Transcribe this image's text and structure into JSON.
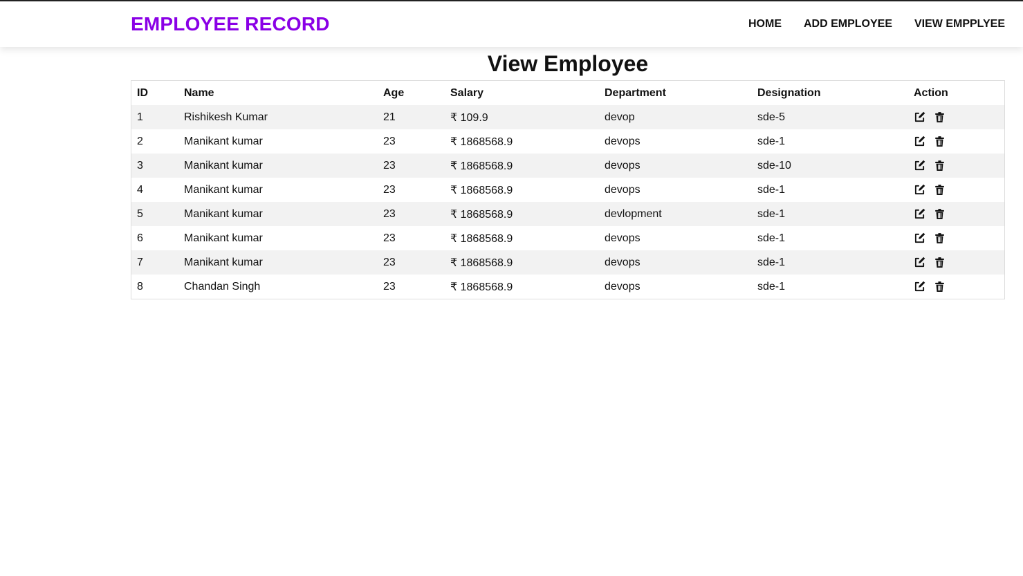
{
  "navbar": {
    "brand": "EMPLOYEE RECORD",
    "links": [
      "HOME",
      "ADD EMPLOYEE",
      "VIEW EMPPLYEE"
    ]
  },
  "page": {
    "title": "View Employee"
  },
  "table": {
    "headers": [
      "ID",
      "Name",
      "Age",
      "Salary",
      "Department",
      "Designation",
      "Action"
    ],
    "rows": [
      [
        "1",
        "Rishikesh Kumar",
        "21",
        "₹ 109.9",
        "devop",
        "sde-5"
      ],
      [
        "2",
        "Manikant kumar",
        "23",
        "₹ 1868568.9",
        "devops",
        "sde-1"
      ],
      [
        "3",
        "Manikant kumar",
        "23",
        "₹ 1868568.9",
        "devops",
        "sde-10"
      ],
      [
        "4",
        "Manikant kumar",
        "23",
        "₹ 1868568.9",
        "devops",
        "sde-1"
      ],
      [
        "5",
        "Manikant kumar",
        "23",
        "₹ 1868568.9",
        "devlopment",
        "sde-1"
      ],
      [
        "6",
        "Manikant kumar",
        "23",
        "₹ 1868568.9",
        "devops",
        "sde-1"
      ],
      [
        "7",
        "Manikant kumar",
        "23",
        "₹ 1868568.9",
        "devops",
        "sde-1"
      ],
      [
        "8",
        "Chandan Singh",
        "23",
        "₹ 1868568.9",
        "devops",
        "sde-1"
      ]
    ],
    "row_actions": [
      "edit-icon",
      "trash-icon"
    ]
  },
  "colors": {
    "brand": "#8a00e6",
    "row_stripe": "#f2f2f2"
  }
}
